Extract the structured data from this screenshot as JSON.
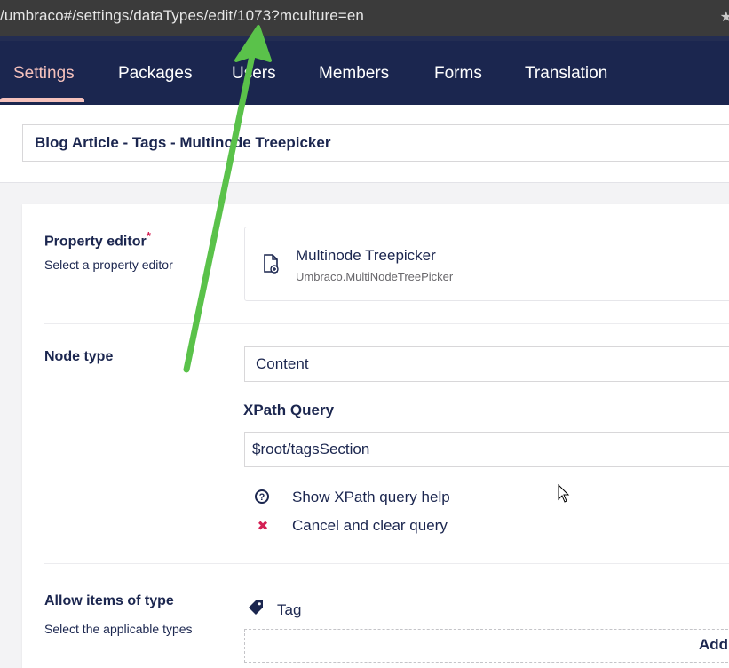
{
  "browser": {
    "url": "/umbraco#/settings/dataTypes/edit/1073?mculture=en",
    "star_icon": "star-icon"
  },
  "nav": {
    "items": [
      {
        "label": "Settings",
        "active": true
      },
      {
        "label": "Packages"
      },
      {
        "label": "Users"
      },
      {
        "label": "Members"
      },
      {
        "label": "Forms"
      },
      {
        "label": "Translation"
      }
    ]
  },
  "header": {
    "name_value": "Blog Article - Tags - Multinode Treepicker"
  },
  "property_editor": {
    "label": "Property editor",
    "required_mark": "*",
    "description": "Select a property editor",
    "selected_name": "Multinode Treepicker",
    "selected_alias": "Umbraco.MultiNodeTreePicker"
  },
  "node_type": {
    "label": "Node type",
    "selected": "Content",
    "xpath_label": "XPath Query",
    "xpath_value": "$root/tagsSection",
    "help_link": "Show XPath query help",
    "cancel_link": "Cancel and clear query"
  },
  "allow_items": {
    "label": "Allow items of type",
    "description": "Select the applicable types",
    "item": "Tag",
    "add_label": "Add"
  },
  "colors": {
    "nav_bg": "#1b264f",
    "active": "#f5c1bc",
    "annotation_arrow": "#5ac24a",
    "danger": "#d42054"
  }
}
